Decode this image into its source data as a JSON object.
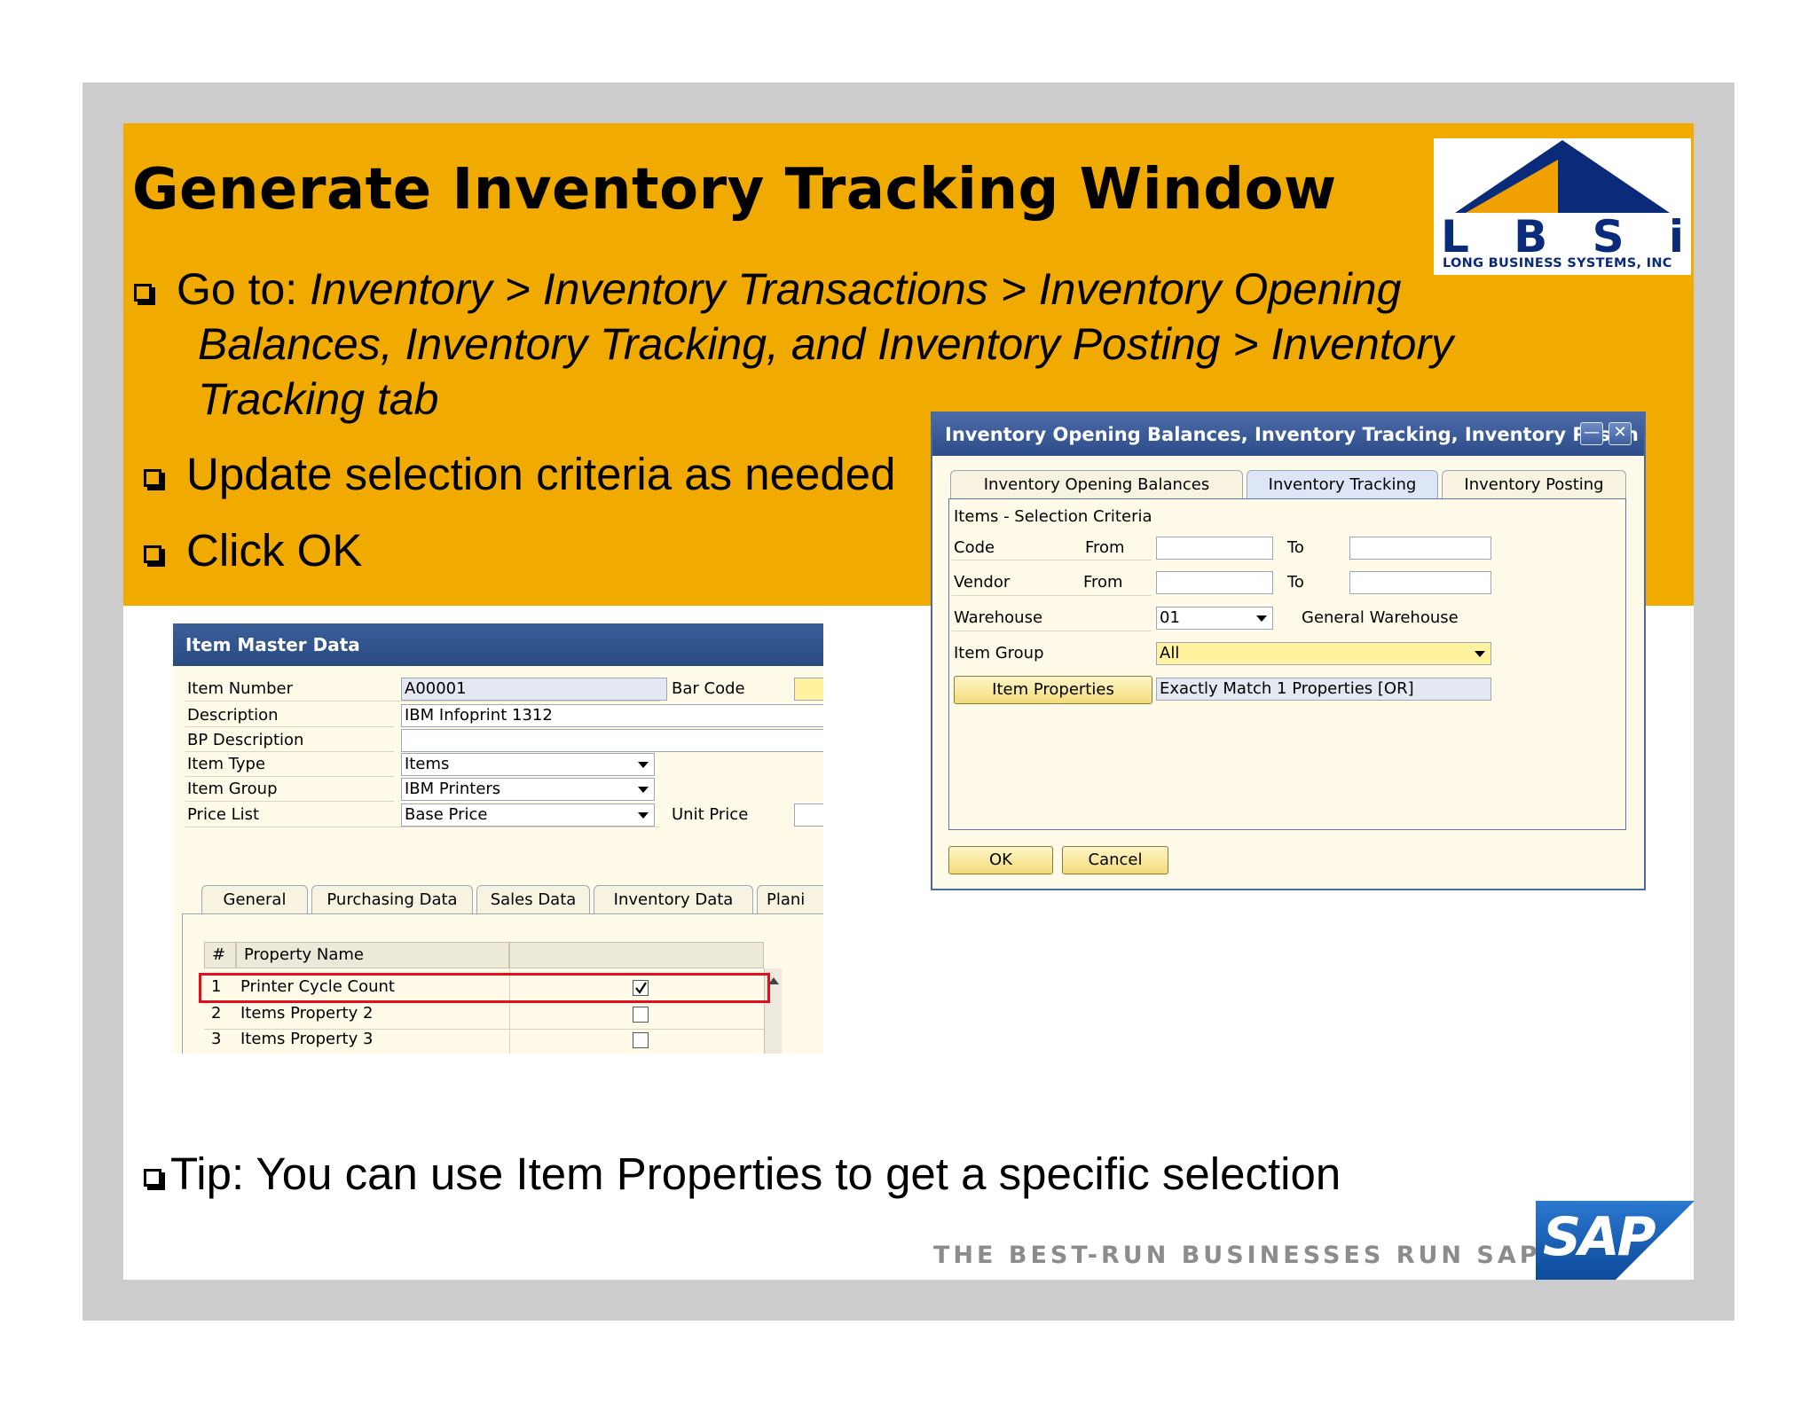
{
  "slide": {
    "title": "Generate Inventory Tracking Window",
    "bullets": {
      "b1_prefix": "Go to:  ",
      "b1_line1": "Inventory > Inventory Transactions > Inventory Opening",
      "b1_line2": "Balances, Inventory Tracking, and Inventory Posting > Inventory",
      "b1_line3": "Tracking tab",
      "b2": "Update selection criteria as needed",
      "b3": "Click OK"
    },
    "tip": "Tip:  You can use Item Properties to get a specific selection",
    "tagline": "THE BEST-RUN BUSINESSES RUN SAP",
    "sap_logo": "SAP"
  },
  "logo": {
    "letters": [
      "L",
      "B",
      "S",
      "i"
    ],
    "subtitle": "LONG BUSINESS SYSTEMS, INC"
  },
  "item_master": {
    "title": "Item Master Data",
    "labels": {
      "item_number": "Item Number",
      "description": "Description",
      "bp_description": "BP Description",
      "item_type": "Item Type",
      "item_group": "Item Group",
      "price_list": "Price List",
      "bar_code": "Bar Code",
      "unit_price": "Unit Price"
    },
    "values": {
      "item_number": "A00001",
      "description": "IBM Infoprint 1312",
      "bp_description": "",
      "item_type": "Items",
      "item_group": "IBM Printers",
      "price_list": "Base Price"
    },
    "tabs": [
      "General",
      "Purchasing Data",
      "Sales Data",
      "Inventory Data",
      "Plani"
    ],
    "grid_headers": {
      "num": "#",
      "name": "Property Name"
    },
    "properties": [
      {
        "num": "1",
        "name": "Printer Cycle Count",
        "checked": true
      },
      {
        "num": "2",
        "name": "Items Property 2",
        "checked": false
      },
      {
        "num": "3",
        "name": "Items Property 3",
        "checked": false
      }
    ]
  },
  "iob_window": {
    "title": "Inventory Opening Balances, Inventory Tracking, Inventory Postin",
    "minimize_icon": "minimize-icon",
    "close_icon": "close-icon",
    "tabs": [
      "Inventory Opening Balances",
      "Inventory Tracking",
      "Inventory Posting"
    ],
    "active_tab": "Inventory Tracking",
    "section": "Items - Selection Criteria",
    "labels": {
      "code": "Code",
      "vendor": "Vendor",
      "warehouse": "Warehouse",
      "item_group": "Item Group",
      "from": "From",
      "to": "To"
    },
    "values": {
      "warehouse": "01",
      "warehouse_name": "General Warehouse",
      "item_group": "All",
      "properties_summary": "Exactly Match 1 Properties [OR]"
    },
    "buttons": {
      "item_properties": "Item Properties",
      "ok": "OK",
      "cancel": "Cancel"
    }
  },
  "colors": {
    "banner": "#f0aa00",
    "frame": "#cccccc",
    "sap_blue": "#1a5fb4",
    "lbsi_blue": "#0a2a7a",
    "lbsi_orange": "#f0a000"
  }
}
